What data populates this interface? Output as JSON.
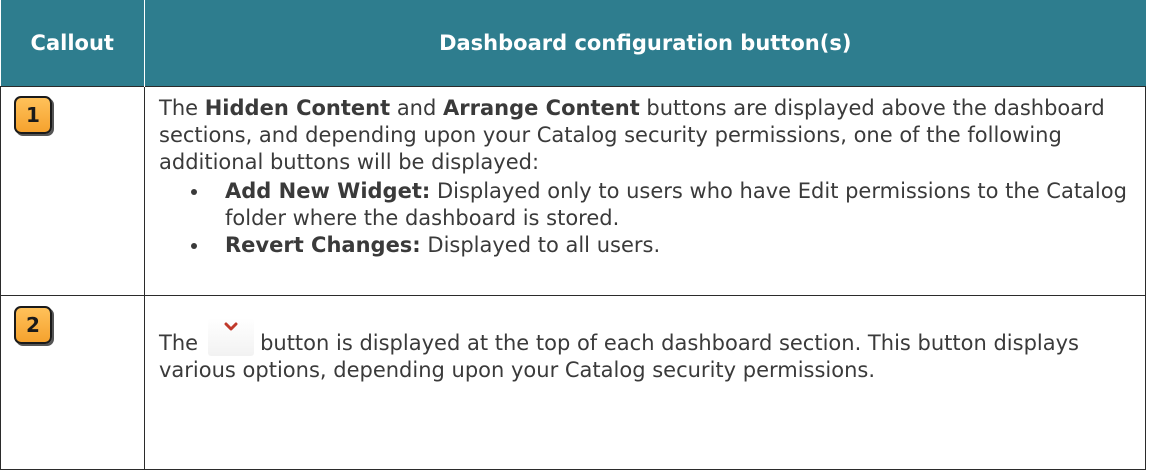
{
  "header": {
    "callout": "Callout",
    "config": "Dashboard configuration button(s)"
  },
  "rows": [
    {
      "badge": "1",
      "intro_pre": "The ",
      "hidden_content": "Hidden Content",
      "and": " and ",
      "arrange_content": "Arrange Content",
      "intro_post": " buttons are displayed above the dashboard sections, and depending upon your Catalog security permissions, one of the following additional buttons will be displayed:",
      "bullets": [
        {
          "title": "Add New Widget:",
          "text": " Displayed only to users who have Edit permissions to the Catalog folder where the dashboard is stored."
        },
        {
          "title": "Revert Changes:",
          "text": " Displayed to all users."
        }
      ]
    },
    {
      "badge": "2",
      "pre": "The",
      "post": "button is displayed at the top of each dashboard section. This button displays various options, depending upon your Catalog security permissions."
    }
  ],
  "colors": {
    "header_bg": "#2e7d8e",
    "badge_fill": "#f5a22e",
    "chevron": "#c0392b"
  },
  "icons": {
    "chevron": "chevron-down-icon"
  }
}
